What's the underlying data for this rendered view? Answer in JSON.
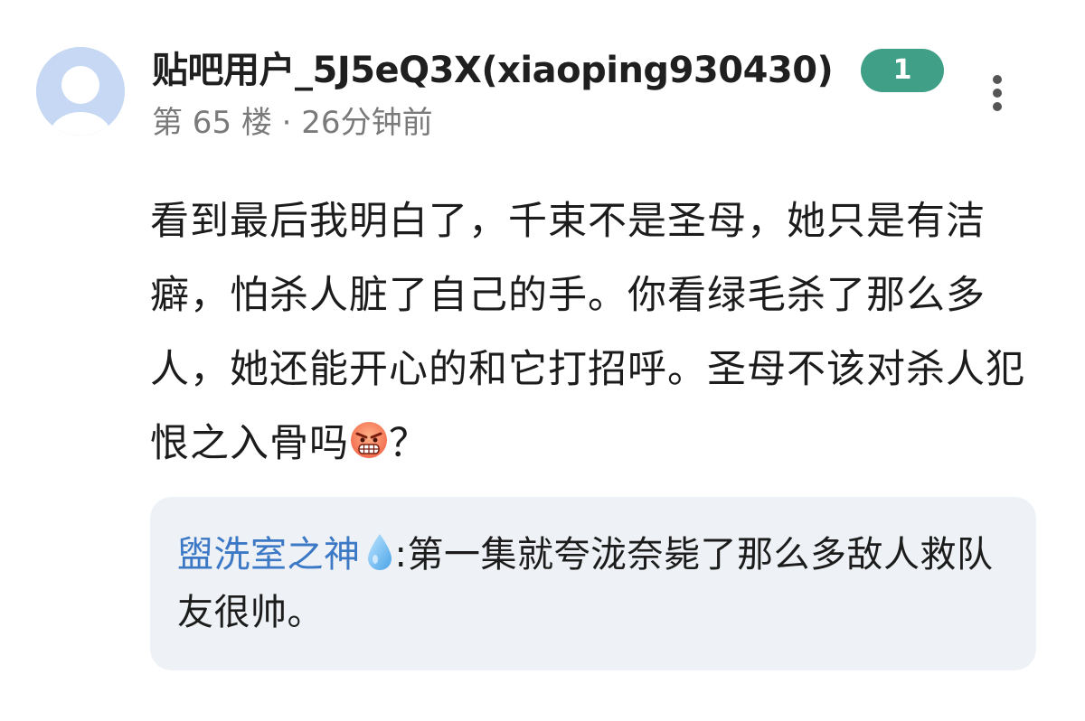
{
  "post": {
    "username": "贴吧用户_5J5eQ3X(xiaoping930430)",
    "level": "1",
    "floor_text": "第 65 楼 · 26分钟前",
    "content_before_emoji": "看到最后我明白了，千束不是圣母，她只是有洁癖，怕杀人脏了自己的手。你看绿毛杀了那么多人，她还能开心的和它打招呼。圣母不该对杀人犯恨之入骨吗",
    "content_after_emoji": "？",
    "emoji_icon": "angry-face-emoji"
  },
  "reply": {
    "author": "盥洗室之神",
    "author_icon": "water-drop-icon",
    "text": ":第一集就夸泷奈毙了那么多敌人救队友很帅。"
  },
  "colors": {
    "badge": "#3f9f87",
    "reply_author": "#3b78c6",
    "reply_bg": "#eef1f5"
  }
}
